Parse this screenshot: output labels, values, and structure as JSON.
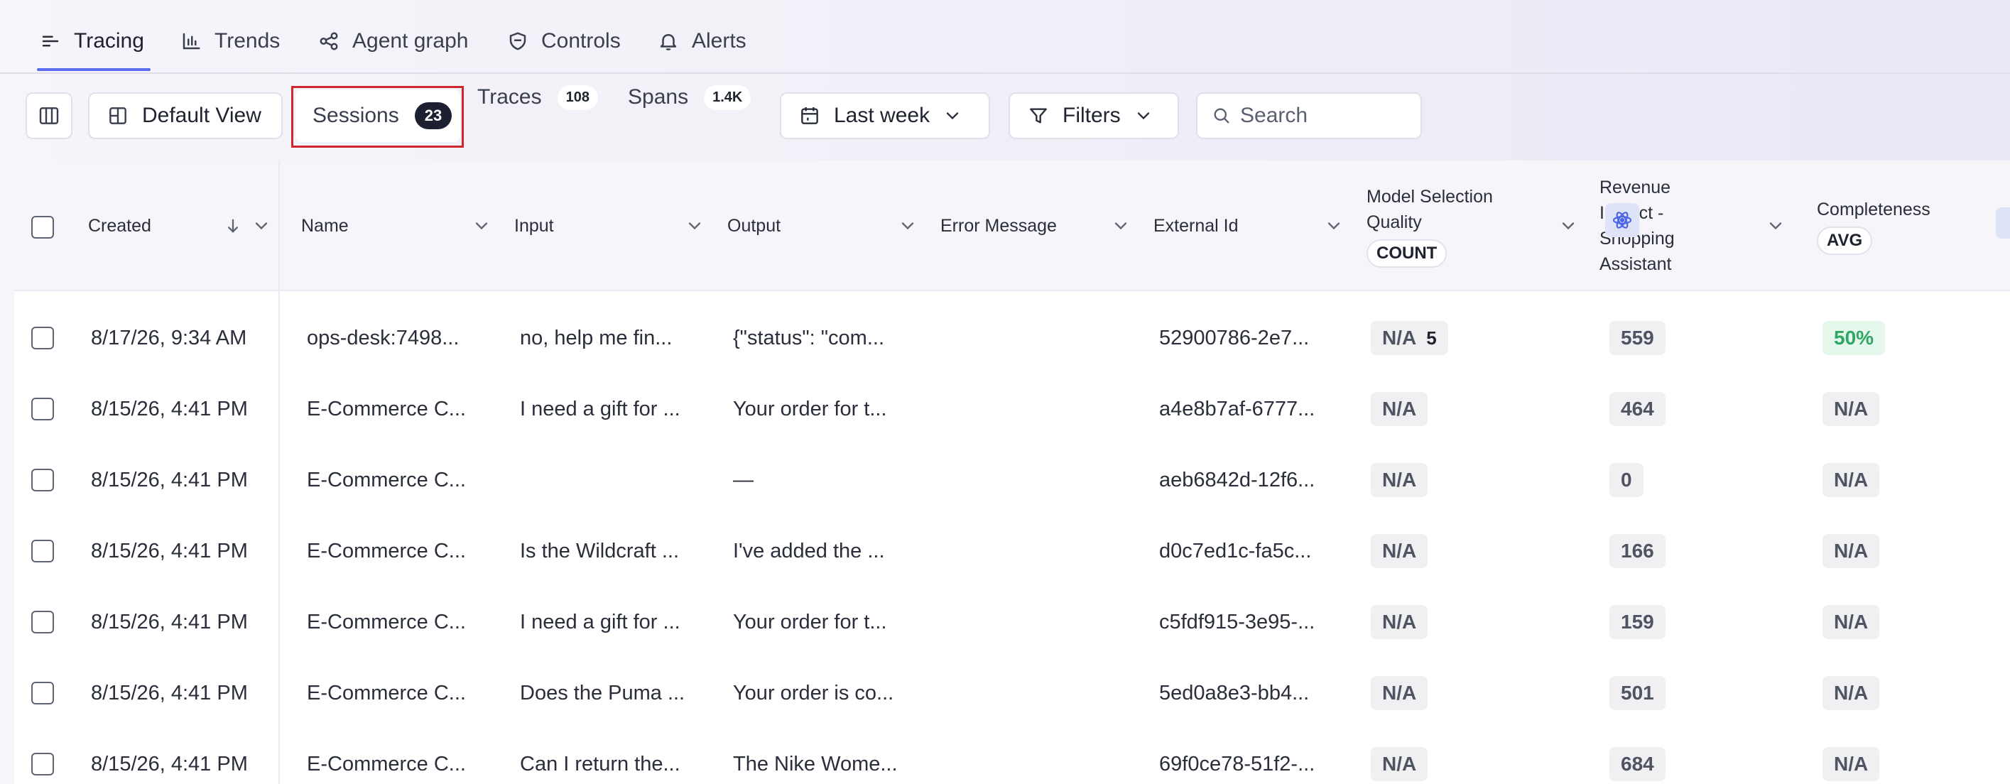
{
  "nav": {
    "tabs": [
      {
        "label": "Tracing",
        "icon": "list-icon",
        "active": true
      },
      {
        "label": "Trends",
        "icon": "bar-chart-icon"
      },
      {
        "label": "Agent graph",
        "icon": "graph-icon"
      },
      {
        "label": "Controls",
        "icon": "shield-icon"
      },
      {
        "label": "Alerts",
        "icon": "bell-icon"
      }
    ]
  },
  "toolbar": {
    "default_view_label": "Default View",
    "segments": [
      {
        "label": "Sessions",
        "count": "23",
        "active": true
      },
      {
        "label": "Traces",
        "count": "108"
      },
      {
        "label": "Spans",
        "count": "1.4K"
      }
    ],
    "date_range_label": "Last week",
    "filters_label": "Filters",
    "search_placeholder": "Search"
  },
  "table": {
    "columns": {
      "created": "Created",
      "name": "Name",
      "input": "Input",
      "output": "Output",
      "error_message": "Error Message",
      "external_id": "External Id",
      "model_selection_quality": {
        "line1": "Model Selection",
        "line2": "Quality",
        "aggregate": "COUNT"
      },
      "revenue_impact": {
        "line1": "Revenue",
        "line2": "Impact -",
        "line3": "Shopping",
        "line4": "Assistant"
      },
      "completeness": {
        "label": "Completeness",
        "aggregate": "AVG"
      }
    },
    "rows": [
      {
        "created": "8/17/26, 9:34 AM",
        "name": "ops-desk:7498...",
        "input": "no, help me fin...",
        "output": "{\"status\": \"com...",
        "external_id": "52900786-2e7...",
        "model_quality": "N/A",
        "model_quality_count": "5",
        "revenue": "559",
        "completeness": "50%"
      },
      {
        "created": "8/15/26, 4:41 PM",
        "name": "E-Commerce C...",
        "input": "I need a gift for ...",
        "output": "Your order for t...",
        "external_id": "a4e8b7af-6777...",
        "model_quality": "N/A",
        "revenue": "464",
        "completeness": "N/A"
      },
      {
        "created": "8/15/26, 4:41 PM",
        "name": "E-Commerce C...",
        "input": "",
        "output": "—",
        "external_id": "aeb6842d-12f6...",
        "model_quality": "N/A",
        "revenue": "0",
        "completeness": "N/A"
      },
      {
        "created": "8/15/26, 4:41 PM",
        "name": "E-Commerce C...",
        "input": "Is the Wildcraft ...",
        "output": "I've added the ...",
        "external_id": "d0c7ed1c-fa5c...",
        "model_quality": "N/A",
        "revenue": "166",
        "completeness": "N/A"
      },
      {
        "created": "8/15/26, 4:41 PM",
        "name": "E-Commerce C...",
        "input": "I need a gift for ...",
        "output": "Your order for t...",
        "external_id": "c5fdf915-3e95-...",
        "model_quality": "N/A",
        "revenue": "159",
        "completeness": "N/A"
      },
      {
        "created": "8/15/26, 4:41 PM",
        "name": "E-Commerce C...",
        "input": "Does the Puma ...",
        "output": "Your order is co...",
        "external_id": "5ed0a8e3-bb4...",
        "model_quality": "N/A",
        "revenue": "501",
        "completeness": "N/A"
      },
      {
        "created": "8/15/26, 4:41 PM",
        "name": "E-Commerce C...",
        "input": "Can I return the...",
        "output": "The Nike Wome...",
        "external_id": "69f0ce78-51f2-...",
        "model_quality": "N/A",
        "revenue": "684",
        "completeness": "N/A"
      }
    ]
  },
  "colors": {
    "accent": "#5b6cf0",
    "highlight": "#d0262e",
    "success_text": "#2fa865",
    "success_bg": "#e6f7ec"
  }
}
